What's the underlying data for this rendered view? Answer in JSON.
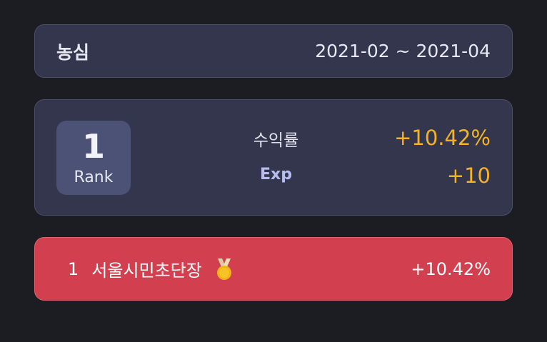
{
  "header": {
    "title": "농심",
    "period": "2021-02 ~ 2021-04"
  },
  "rank_card": {
    "rank": "1",
    "rank_label": "Rank",
    "return_label": "수익률",
    "return_value": "+10.42%",
    "exp_label": "Exp",
    "exp_value": "+10"
  },
  "my_entry": {
    "rank": "1",
    "name": "서울시민초단장",
    "medal_icon": "gold-medal-icon",
    "return_value": "+10.42%"
  },
  "colors": {
    "background": "#1c1d22",
    "card": "#33364c",
    "badge": "#4c5176",
    "accent_value": "#f5b324",
    "highlight_row": "#d2404f",
    "medal_gold": "#f2b516"
  }
}
